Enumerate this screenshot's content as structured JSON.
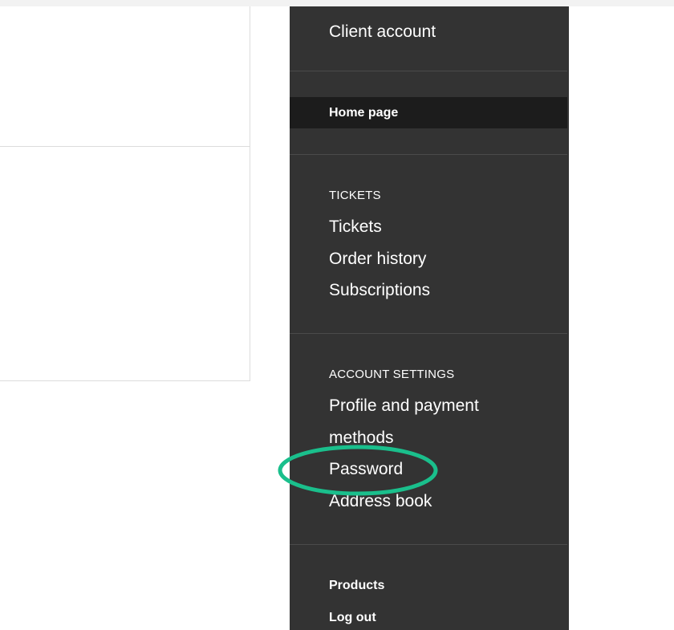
{
  "sidebar": {
    "title": "Client account",
    "home_page": "Home page",
    "tickets_section": {
      "heading": "TICKETS",
      "items": [
        "Tickets",
        "Order history",
        "Subscriptions"
      ]
    },
    "account_settings_section": {
      "heading": "ACCOUNT SETTINGS",
      "items": [
        "Profile and payment",
        "methods",
        "Password",
        "Address book"
      ]
    },
    "footer_links": [
      "Products",
      "Log out"
    ]
  },
  "highlight": {
    "color": "#1abf8c",
    "target": "Password"
  },
  "colors": {
    "sidebar_bg": "#333333",
    "active_bg": "#1c1c1c",
    "text": "#ffffff"
  }
}
